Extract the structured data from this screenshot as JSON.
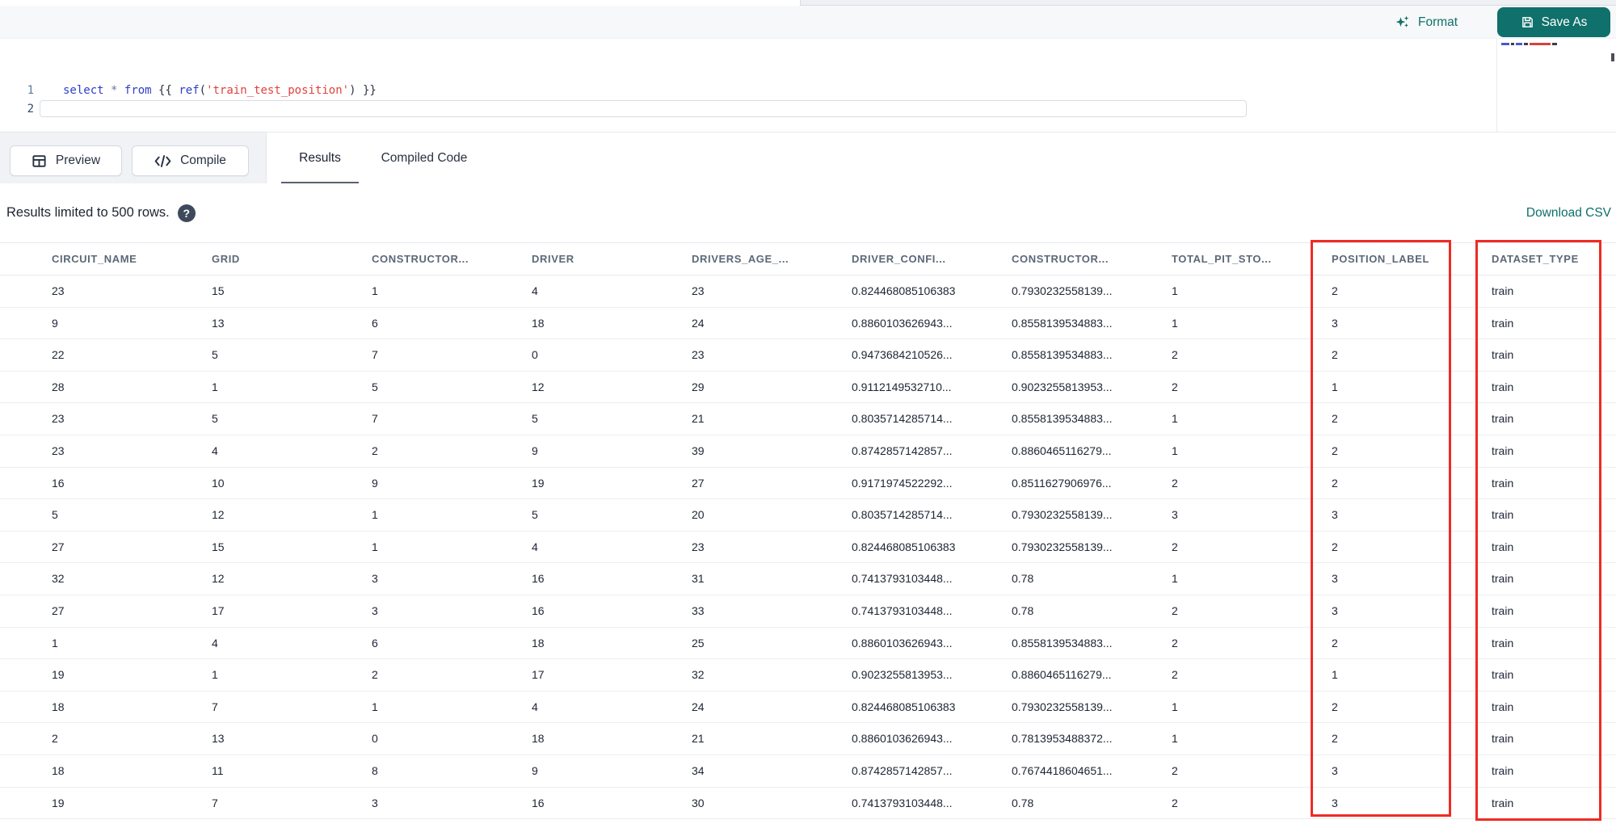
{
  "editor_header": {
    "format_label": "Format",
    "save_as_label": "Save As"
  },
  "editor": {
    "lines": [
      {
        "number": "1"
      },
      {
        "number": "2"
      }
    ],
    "tokens": [
      {
        "t": "select",
        "c": "keyword"
      },
      {
        "t": " ",
        "c": "plain"
      },
      {
        "t": "*",
        "c": "operator"
      },
      {
        "t": " ",
        "c": "plain"
      },
      {
        "t": "from",
        "c": "keyword"
      },
      {
        "t": " ",
        "c": "plain"
      },
      {
        "t": "{{",
        "c": "punct"
      },
      {
        "t": " ",
        "c": "plain"
      },
      {
        "t": "ref",
        "c": "function"
      },
      {
        "t": "(",
        "c": "punct"
      },
      {
        "t": "'train_test_position'",
        "c": "string"
      },
      {
        "t": ")",
        "c": "punct"
      },
      {
        "t": " ",
        "c": "plain"
      },
      {
        "t": "}}",
        "c": "punct"
      }
    ]
  },
  "toolbar": {
    "preview_label": "Preview",
    "compile_label": "Compile"
  },
  "tabs": [
    {
      "label": "Results",
      "active": true
    },
    {
      "label": "Compiled Code",
      "active": false
    }
  ],
  "results_bar": {
    "limit_text": "Results limited to 500 rows.",
    "download_csv_label": "Download CSV"
  },
  "table": {
    "headers": [
      "CIRCUIT_NAME",
      "GRID",
      "CONSTRUCTOR...",
      "DRIVER",
      "DRIVERS_AGE_...",
      "DRIVER_CONFI...",
      "CONSTRUCTOR...",
      "TOTAL_PIT_STO...",
      "POSITION_LABEL",
      "DATASET_TYPE"
    ],
    "rows": [
      [
        "23",
        "15",
        "1",
        "4",
        "23",
        "0.824468085106383",
        "0.7930232558139...",
        "1",
        "2",
        "train"
      ],
      [
        "9",
        "13",
        "6",
        "18",
        "24",
        "0.8860103626943...",
        "0.8558139534883...",
        "1",
        "3",
        "train"
      ],
      [
        "22",
        "5",
        "7",
        "0",
        "23",
        "0.9473684210526...",
        "0.8558139534883...",
        "2",
        "2",
        "train"
      ],
      [
        "28",
        "1",
        "5",
        "12",
        "29",
        "0.9112149532710...",
        "0.9023255813953...",
        "2",
        "1",
        "train"
      ],
      [
        "23",
        "5",
        "7",
        "5",
        "21",
        "0.8035714285714...",
        "0.8558139534883...",
        "1",
        "2",
        "train"
      ],
      [
        "23",
        "4",
        "2",
        "9",
        "39",
        "0.8742857142857...",
        "0.8860465116279...",
        "1",
        "2",
        "train"
      ],
      [
        "16",
        "10",
        "9",
        "19",
        "27",
        "0.9171974522292...",
        "0.8511627906976...",
        "2",
        "2",
        "train"
      ],
      [
        "5",
        "12",
        "1",
        "5",
        "20",
        "0.8035714285714...",
        "0.7930232558139...",
        "3",
        "3",
        "train"
      ],
      [
        "27",
        "15",
        "1",
        "4",
        "23",
        "0.824468085106383",
        "0.7930232558139...",
        "2",
        "2",
        "train"
      ],
      [
        "32",
        "12",
        "3",
        "16",
        "31",
        "0.7413793103448...",
        "0.78",
        "1",
        "3",
        "train"
      ],
      [
        "27",
        "17",
        "3",
        "16",
        "33",
        "0.7413793103448...",
        "0.78",
        "2",
        "3",
        "train"
      ],
      [
        "1",
        "4",
        "6",
        "18",
        "25",
        "0.8860103626943...",
        "0.8558139534883...",
        "2",
        "2",
        "train"
      ],
      [
        "19",
        "1",
        "2",
        "17",
        "32",
        "0.9023255813953...",
        "0.8860465116279...",
        "2",
        "1",
        "train"
      ],
      [
        "18",
        "7",
        "1",
        "4",
        "24",
        "0.824468085106383",
        "0.7930232558139...",
        "1",
        "2",
        "train"
      ],
      [
        "2",
        "13",
        "0",
        "18",
        "21",
        "0.8860103626943...",
        "0.7813953488372...",
        "1",
        "2",
        "train"
      ],
      [
        "18",
        "11",
        "8",
        "9",
        "34",
        "0.8742857142857...",
        "0.7674418604651...",
        "2",
        "3",
        "train"
      ],
      [
        "19",
        "7",
        "3",
        "16",
        "30",
        "0.7413793103448...",
        "0.78",
        "2",
        "3",
        "train"
      ]
    ]
  },
  "annotations": {
    "highlight_color": "#ee2b24",
    "highlighted_columns": [
      "POSITION_LABEL",
      "DATASET_TYPE"
    ]
  },
  "colors": {
    "accent_teal": "#10706b",
    "annotation_red": "#ee2b24",
    "keyword_blue": "#2f3ec7",
    "string_red": "#e0423e"
  }
}
